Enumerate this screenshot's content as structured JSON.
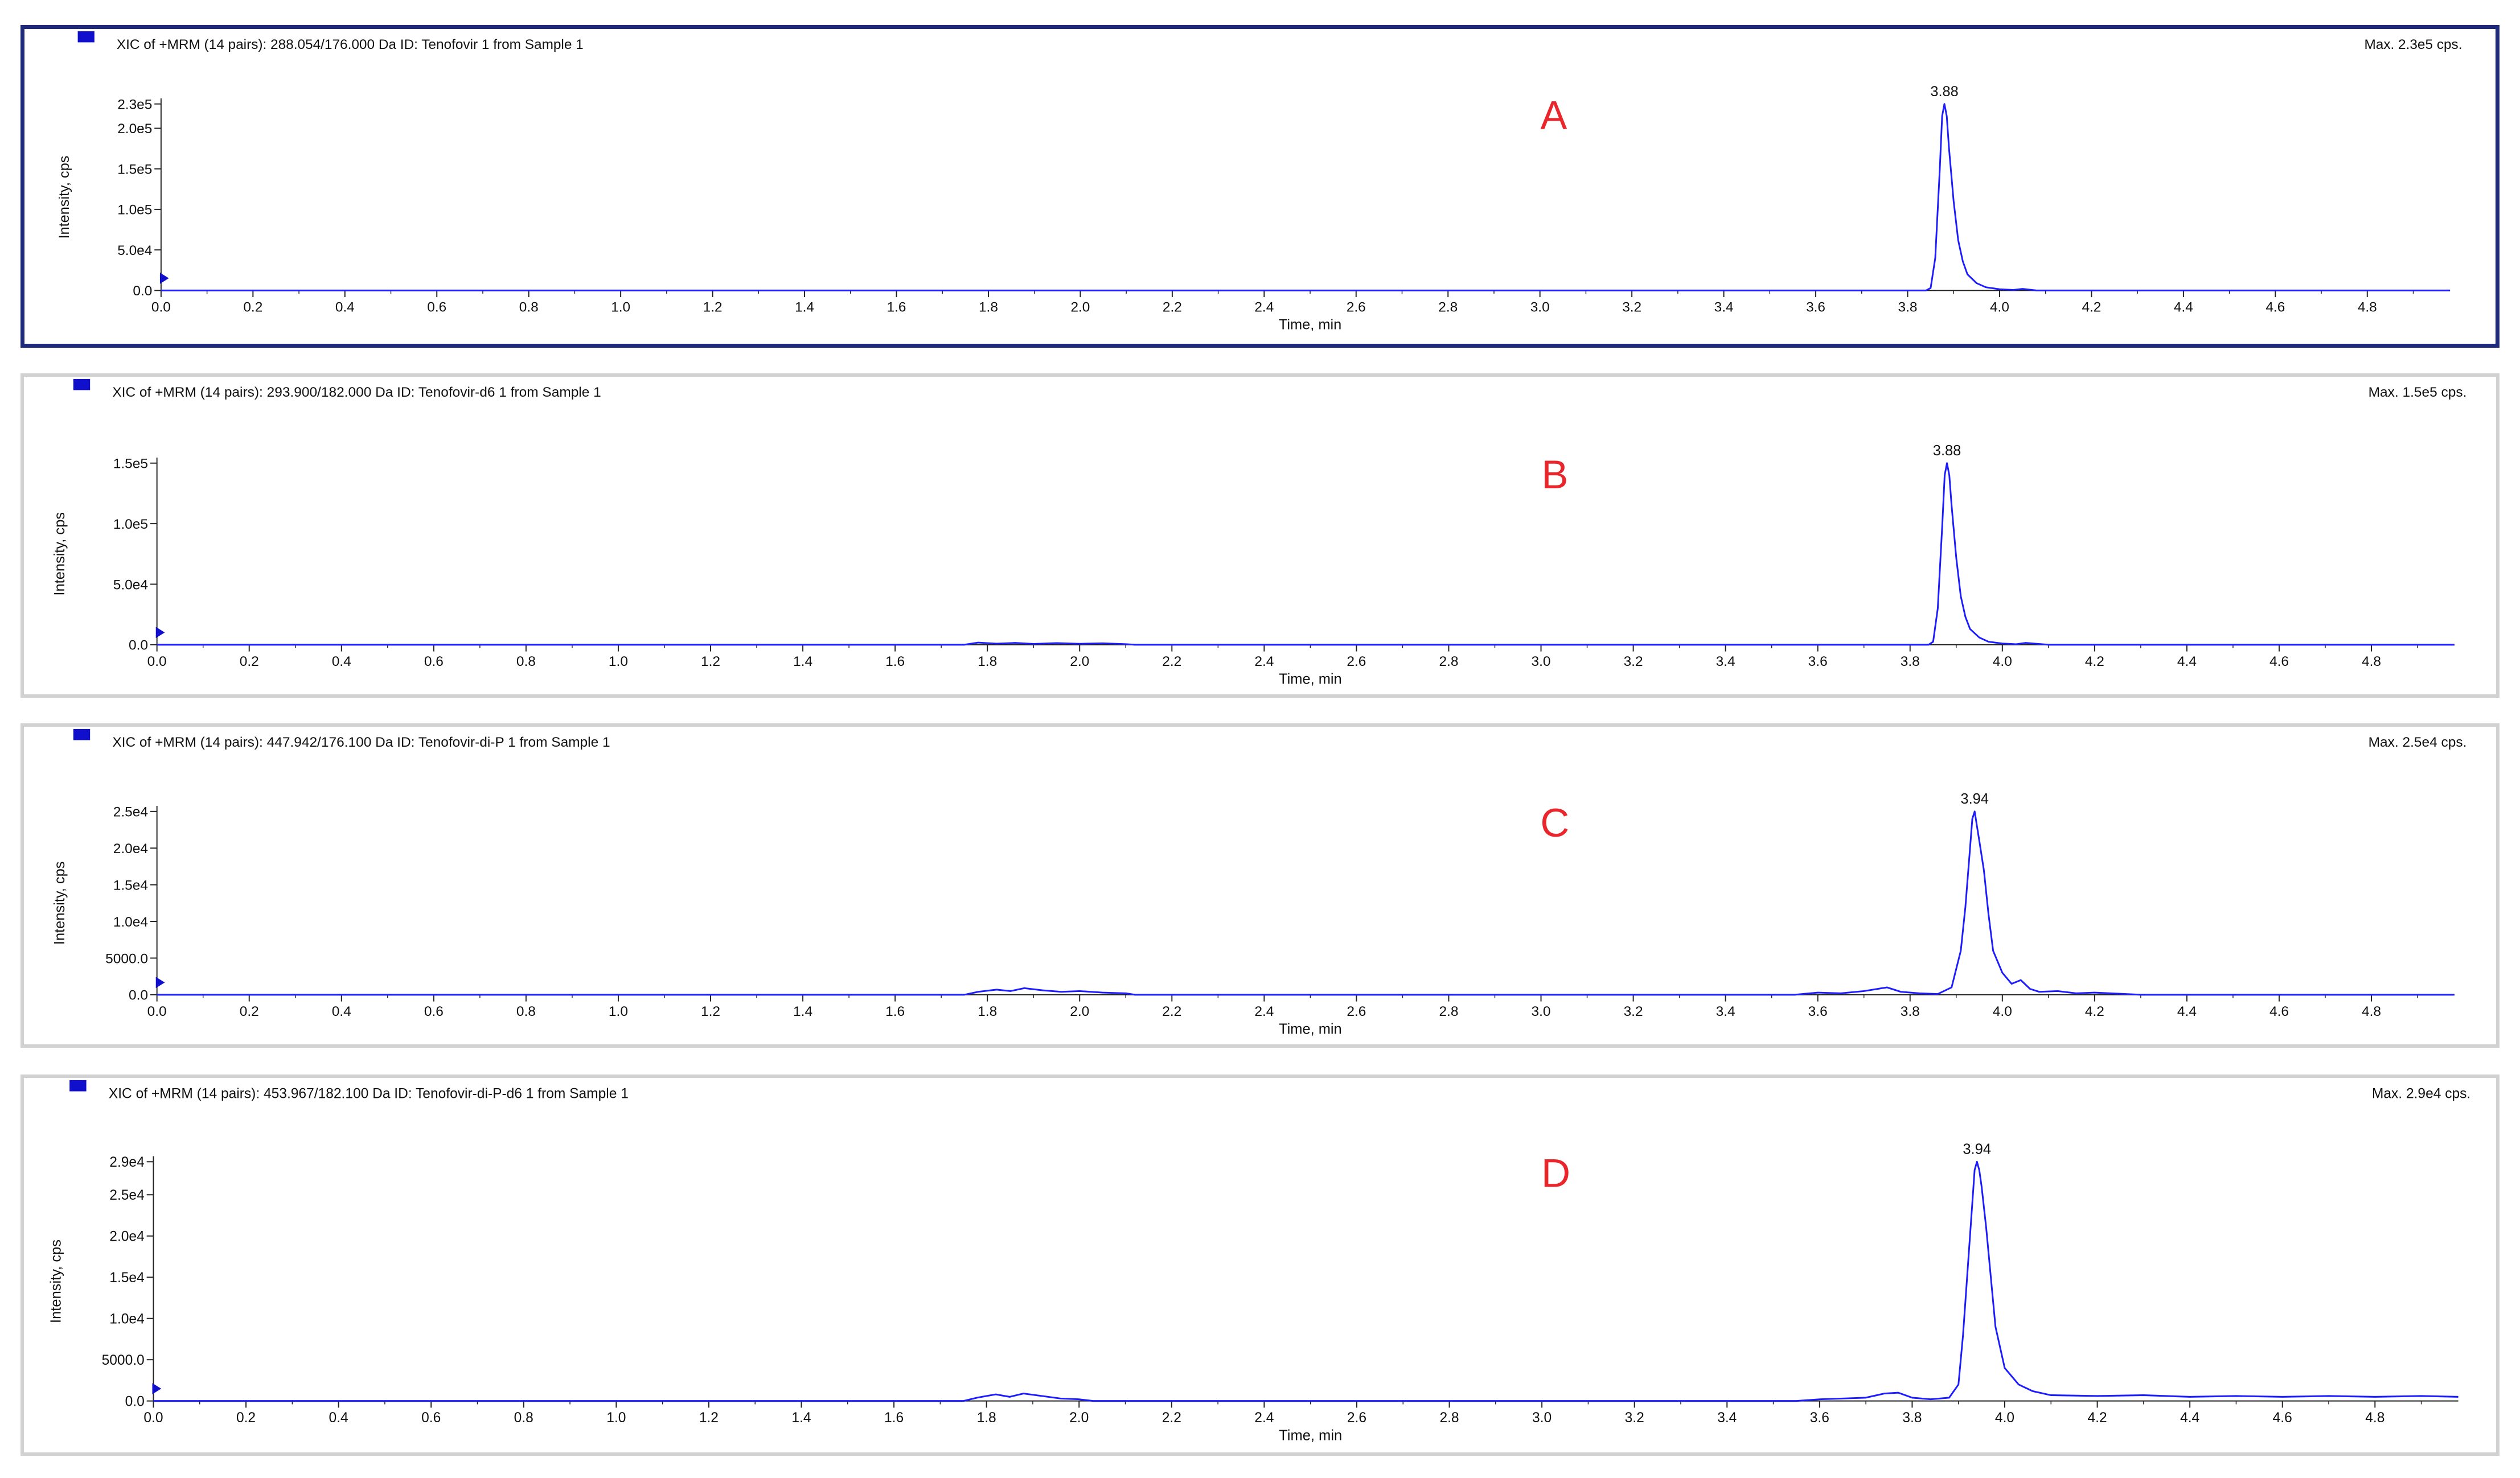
{
  "style": {
    "trace_color": "#1c1cff",
    "legend_color": "#1010cc",
    "letter_color": "#e8262b",
    "selected_border": "#1f2a7a",
    "panel_border": "#d2d2d2"
  },
  "chart_data": [
    {
      "type": "line",
      "letter": "A",
      "selected": true,
      "header": "XIC of +MRM (14 pairs): 288.054/176.000 Da ID: Tenofovir 1 from Sample 1",
      "max_label": "Max. 2.3e5 cps.",
      "xlabel": "Time, min",
      "ylabel": "Intensity, cps",
      "xlim": [
        0.0,
        4.98
      ],
      "ylim": [
        0,
        230000
      ],
      "x_ticks": [
        "0.0",
        "0.2",
        "0.4",
        "0.6",
        "0.8",
        "1.0",
        "1.2",
        "1.4",
        "1.6",
        "1.8",
        "2.0",
        "2.2",
        "2.4",
        "2.6",
        "2.8",
        "3.0",
        "3.2",
        "3.4",
        "3.6",
        "3.8",
        "4.0",
        "4.2",
        "4.4",
        "4.6",
        "4.8"
      ],
      "y_ticks": [
        {
          "value": 0,
          "label": "0.0"
        },
        {
          "value": 50000,
          "label": "5.0e4"
        },
        {
          "value": 100000,
          "label": "1.0e5"
        },
        {
          "value": 150000,
          "label": "1.5e5"
        },
        {
          "value": 200000,
          "label": "2.0e5"
        },
        {
          "value": 230000,
          "label": "2.3e5"
        }
      ],
      "peak_label": "3.88",
      "peak": {
        "x": 3.88,
        "y": 230000
      },
      "series": [
        {
          "x": [
            0.0,
            3.84,
            3.85,
            3.86,
            3.87,
            3.875,
            3.88,
            3.885,
            3.89,
            3.9,
            3.91,
            3.92,
            3.93,
            3.95,
            3.97,
            4.0,
            4.03,
            4.05,
            4.08,
            4.98
          ],
          "y": [
            0,
            0,
            3000,
            40000,
            150000,
            215000,
            230000,
            215000,
            175000,
            110000,
            62000,
            36000,
            20000,
            9000,
            4000,
            1500,
            600,
            2000,
            0,
            0
          ]
        }
      ]
    },
    {
      "type": "line",
      "letter": "B",
      "selected": false,
      "header": "XIC of +MRM (14 pairs): 293.900/182.000 Da ID: Tenofovir-d6 1 from Sample 1",
      "max_label": "Max. 1.5e5 cps.",
      "xlabel": "Time, min",
      "ylabel": "Intensity, cps",
      "xlim": [
        0.0,
        4.98
      ],
      "ylim": [
        0,
        150000
      ],
      "x_ticks": [
        "0.0",
        "0.2",
        "0.4",
        "0.6",
        "0.8",
        "1.0",
        "1.2",
        "1.4",
        "1.6",
        "1.8",
        "2.0",
        "2.2",
        "2.4",
        "2.6",
        "2.8",
        "3.0",
        "3.2",
        "3.4",
        "3.6",
        "3.8",
        "4.0",
        "4.2",
        "4.4",
        "4.6",
        "4.8"
      ],
      "y_ticks": [
        {
          "value": 0,
          "label": "0.0"
        },
        {
          "value": 50000,
          "label": "5.0e4"
        },
        {
          "value": 100000,
          "label": "1.0e5"
        },
        {
          "value": 150000,
          "label": "1.5e5"
        }
      ],
      "peak_label": "3.88",
      "peak": {
        "x": 3.88,
        "y": 150000
      },
      "series": [
        {
          "x": [
            0.0,
            1.75,
            1.78,
            1.82,
            1.86,
            1.9,
            1.95,
            2.0,
            2.05,
            2.1,
            2.12,
            3.84,
            3.85,
            3.86,
            3.87,
            3.875,
            3.88,
            3.885,
            3.89,
            3.9,
            3.91,
            3.92,
            3.93,
            3.95,
            3.97,
            4.0,
            4.03,
            4.05,
            4.1,
            4.98
          ],
          "y": [
            0,
            0,
            1800,
            900,
            1500,
            700,
            1400,
            800,
            1200,
            500,
            0,
            0,
            2500,
            30000,
            100000,
            140000,
            150000,
            140000,
            115000,
            72000,
            40000,
            23000,
            13000,
            6000,
            2500,
            1000,
            400,
            1500,
            0,
            0
          ]
        }
      ]
    },
    {
      "type": "line",
      "letter": "C",
      "selected": false,
      "header": "XIC of +MRM (14 pairs): 447.942/176.100 Da ID: Tenofovir-di-P 1 from Sample 1",
      "max_label": "Max. 2.5e4 cps.",
      "xlabel": "Time, min",
      "ylabel": "Intensity, cps",
      "xlim": [
        0.0,
        4.98
      ],
      "ylim": [
        0,
        25000
      ],
      "x_ticks": [
        "0.0",
        "0.2",
        "0.4",
        "0.6",
        "0.8",
        "1.0",
        "1.2",
        "1.4",
        "1.6",
        "1.8",
        "2.0",
        "2.2",
        "2.4",
        "2.6",
        "2.8",
        "3.0",
        "3.2",
        "3.4",
        "3.6",
        "3.8",
        "4.0",
        "4.2",
        "4.4",
        "4.6",
        "4.8"
      ],
      "y_ticks": [
        {
          "value": 0,
          "label": "0.0"
        },
        {
          "value": 5000,
          "label": "5000.0"
        },
        {
          "value": 10000,
          "label": "1.0e4"
        },
        {
          "value": 15000,
          "label": "1.5e4"
        },
        {
          "value": 20000,
          "label": "2.0e4"
        },
        {
          "value": 25000,
          "label": "2.5e4"
        }
      ],
      "peak_label": "3.94",
      "peak": {
        "x": 3.94,
        "y": 25000
      },
      "series": [
        {
          "x": [
            0.0,
            1.75,
            1.78,
            1.82,
            1.85,
            1.88,
            1.92,
            1.96,
            2.0,
            2.05,
            2.1,
            2.12,
            3.55,
            3.6,
            3.65,
            3.7,
            3.75,
            3.78,
            3.82,
            3.86,
            3.89,
            3.91,
            3.92,
            3.93,
            3.935,
            3.94,
            3.945,
            3.95,
            3.96,
            3.97,
            3.98,
            4.0,
            4.02,
            4.04,
            4.06,
            4.08,
            4.12,
            4.16,
            4.2,
            4.3,
            4.98
          ],
          "y": [
            0,
            0,
            400,
            700,
            500,
            900,
            600,
            400,
            500,
            300,
            200,
            0,
            0,
            300,
            200,
            500,
            1000,
            400,
            200,
            100,
            1000,
            6000,
            12000,
            20000,
            24000,
            25000,
            23000,
            21000,
            17000,
            11000,
            6000,
            3000,
            1500,
            2000,
            800,
            400,
            500,
            200,
            300,
            0,
            0
          ]
        }
      ]
    },
    {
      "type": "line",
      "letter": "D",
      "selected": false,
      "header": "XIC of +MRM (14 pairs): 453.967/182.100 Da ID: Tenofovir-di-P-d6 1 from Sample 1",
      "max_label": "Max. 2.9e4 cps.",
      "xlabel": "Time, min",
      "ylabel": "Intensity, cps",
      "xlim": [
        0.0,
        4.98
      ],
      "ylim": [
        0,
        29000
      ],
      "x_ticks": [
        "0.0",
        "0.2",
        "0.4",
        "0.6",
        "0.8",
        "1.0",
        "1.2",
        "1.4",
        "1.6",
        "1.8",
        "2.0",
        "2.2",
        "2.4",
        "2.6",
        "2.8",
        "3.0",
        "3.2",
        "3.4",
        "3.6",
        "3.8",
        "4.0",
        "4.2",
        "4.4",
        "4.6",
        "4.8"
      ],
      "y_ticks": [
        {
          "value": 0,
          "label": "0.0"
        },
        {
          "value": 5000,
          "label": "5000.0"
        },
        {
          "value": 10000,
          "label": "1.0e4"
        },
        {
          "value": 15000,
          "label": "1.5e4"
        },
        {
          "value": 20000,
          "label": "2.0e4"
        },
        {
          "value": 25000,
          "label": "2.5e4"
        },
        {
          "value": 29000,
          "label": "2.9e4"
        }
      ],
      "peak_label": "3.94",
      "peak": {
        "x": 3.94,
        "y": 29000
      },
      "series": [
        {
          "x": [
            0.0,
            1.75,
            1.78,
            1.82,
            1.85,
            1.88,
            1.92,
            1.96,
            2.0,
            2.03,
            3.55,
            3.6,
            3.65,
            3.7,
            3.74,
            3.77,
            3.8,
            3.84,
            3.88,
            3.9,
            3.91,
            3.92,
            3.93,
            3.935,
            3.94,
            3.945,
            3.95,
            3.96,
            3.97,
            3.98,
            4.0,
            4.03,
            4.06,
            4.1,
            4.2,
            4.3,
            4.4,
            4.5,
            4.6,
            4.7,
            4.8,
            4.9,
            4.98
          ],
          "y": [
            0,
            0,
            400,
            800,
            500,
            900,
            600,
            300,
            200,
            0,
            0,
            200,
            300,
            400,
            900,
            1000,
            400,
            200,
            400,
            2000,
            8000,
            16000,
            24000,
            28000,
            29000,
            28000,
            26000,
            21000,
            15000,
            9000,
            4000,
            2000,
            1200,
            700,
            600,
            700,
            500,
            600,
            500,
            600,
            500,
            600,
            500
          ]
        }
      ]
    }
  ]
}
